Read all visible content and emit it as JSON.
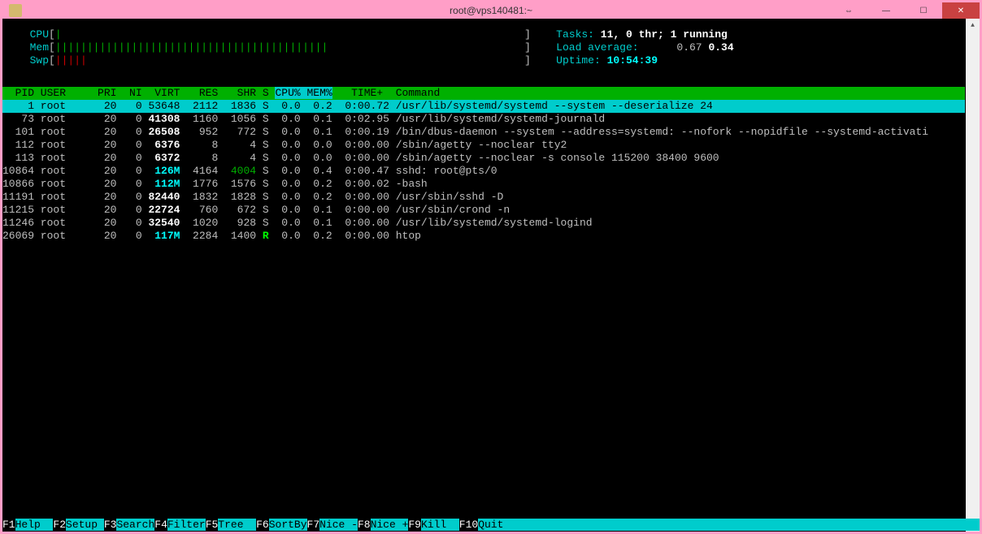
{
  "window": {
    "title": "root@vps140481:~"
  },
  "meters": {
    "cpu_label": "CPU",
    "mem_label": "Mem",
    "swp_label": "Swp",
    "tasks_label": "Tasks: ",
    "tasks_value": "11, 0 thr; 1 running",
    "load_label": "Load average:",
    "load_v1": "0.67",
    "load_v2": "0.34",
    "uptime_label": "Uptime: ",
    "uptime_value": "10:54:39"
  },
  "header": {
    "pid": "  PID",
    "user": "USER",
    "pri": "PRI",
    "ni": " NI",
    "virt": " VIRT",
    "res": "  RES",
    "shr": "  SHR",
    "s": "S",
    "cpu": "CPU%",
    "mem": "MEM%",
    "time": "  TIME+ ",
    "cmd": "Command"
  },
  "rows": [
    {
      "pid": "1",
      "user": "root",
      "pri": "20",
      "ni": "0",
      "virt": "53648",
      "res": "2112",
      "shr": "1836",
      "s": "S",
      "cpu": "0.0",
      "mem": "0.2",
      "time": "0:00.72",
      "cmd": "/usr/lib/systemd/systemd --system --deserialize 24",
      "sel": true
    },
    {
      "pid": "73",
      "user": "root",
      "pri": "20",
      "ni": "0",
      "virt": "41308",
      "res": "1160",
      "shr": "1056",
      "s": "S",
      "cpu": "0.0",
      "mem": "0.1",
      "time": "0:02.95",
      "cmd": "/usr/lib/systemd/systemd-journald"
    },
    {
      "pid": "101",
      "user": "root",
      "pri": "20",
      "ni": "0",
      "virt": "26508",
      "res": "952",
      "shr": "772",
      "s": "S",
      "cpu": "0.0",
      "mem": "0.1",
      "time": "0:00.19",
      "cmd": "/bin/dbus-daemon --system --address=systemd: --nofork --nopidfile --systemd-activati"
    },
    {
      "pid": "112",
      "user": "root",
      "pri": "20",
      "ni": "0",
      "virt": "6376",
      "res": "8",
      "shr": "4",
      "s": "S",
      "cpu": "0.0",
      "mem": "0.0",
      "time": "0:00.00",
      "cmd": "/sbin/agetty --noclear tty2"
    },
    {
      "pid": "113",
      "user": "root",
      "pri": "20",
      "ni": "0",
      "virt": "6372",
      "res": "8",
      "shr": "4",
      "s": "S",
      "cpu": "0.0",
      "mem": "0.0",
      "time": "0:00.00",
      "cmd": "/sbin/agetty --noclear -s console 115200 38400 9600"
    },
    {
      "pid": "10864",
      "user": "root",
      "pri": "20",
      "ni": "0",
      "virt": "126M",
      "virtC": true,
      "res": "4164",
      "shr": "4004",
      "shrG": true,
      "s": "S",
      "cpu": "0.0",
      "mem": "0.4",
      "time": "0:00.47",
      "cmd": "sshd: root@pts/0"
    },
    {
      "pid": "10866",
      "user": "root",
      "pri": "20",
      "ni": "0",
      "virt": "112M",
      "virtC": true,
      "res": "1776",
      "shr": "1576",
      "s": "S",
      "cpu": "0.0",
      "mem": "0.2",
      "time": "0:00.02",
      "cmd": "-bash"
    },
    {
      "pid": "11191",
      "user": "root",
      "pri": "20",
      "ni": "0",
      "virt": "82440",
      "res": "1832",
      "shr": "1828",
      "s": "S",
      "cpu": "0.0",
      "mem": "0.2",
      "time": "0:00.00",
      "cmd": "/usr/sbin/sshd -D"
    },
    {
      "pid": "11215",
      "user": "root",
      "pri": "20",
      "ni": "0",
      "virt": "22724",
      "res": "760",
      "shr": "672",
      "s": "S",
      "cpu": "0.0",
      "mem": "0.1",
      "time": "0:00.00",
      "cmd": "/usr/sbin/crond -n"
    },
    {
      "pid": "11246",
      "user": "root",
      "pri": "20",
      "ni": "0",
      "virt": "32540",
      "res": "1020",
      "shr": "928",
      "s": "S",
      "cpu": "0.0",
      "mem": "0.1",
      "time": "0:00.00",
      "cmd": "/usr/lib/systemd/systemd-logind"
    },
    {
      "pid": "26069",
      "user": "root",
      "pri": "20",
      "ni": "0",
      "virt": "117M",
      "virtC": true,
      "res": "2284",
      "shr": "1400",
      "s": "R",
      "sR": true,
      "cpu": "0.0",
      "mem": "0.2",
      "time": "0:00.00",
      "cmd": "htop"
    }
  ],
  "footer": [
    {
      "key": "F1",
      "label": "Help  "
    },
    {
      "key": "F2",
      "label": "Setup "
    },
    {
      "key": "F3",
      "label": "Search"
    },
    {
      "key": "F4",
      "label": "Filter"
    },
    {
      "key": "F5",
      "label": "Tree  "
    },
    {
      "key": "F6",
      "label": "SortBy"
    },
    {
      "key": "F7",
      "label": "Nice -"
    },
    {
      "key": "F8",
      "label": "Nice +"
    },
    {
      "key": "F9",
      "label": "Kill  "
    },
    {
      "key": "F10",
      "label": "Quit  "
    }
  ]
}
